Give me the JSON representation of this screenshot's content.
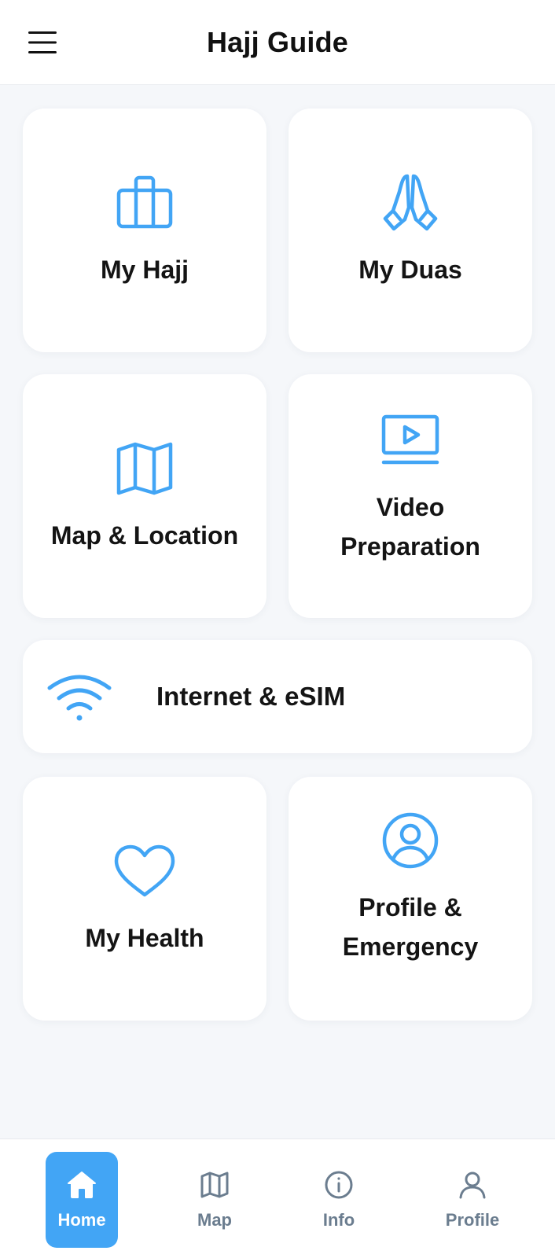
{
  "header": {
    "title": "Hajj Guide",
    "menu_icon": "hamburger-menu-icon"
  },
  "accent_color": "#42A5F5",
  "tiles": [
    {
      "label": "My Hajj",
      "icon": "briefcase-icon"
    },
    {
      "label": "My Duas",
      "icon": "praying-hands-icon"
    },
    {
      "label": "Map & Location",
      "icon": "map-icon"
    },
    {
      "label_lines": [
        "Video",
        "Preparation"
      ],
      "icon": "video-play-icon"
    },
    {
      "label": "My Health",
      "icon": "heart-icon"
    },
    {
      "label_lines": [
        "Profile &",
        "Emergency"
      ],
      "icon": "user-circle-icon"
    }
  ],
  "wide_card": {
    "label": "Internet & eSIM",
    "icon": "wifi-icon"
  },
  "bottom_nav": {
    "active": "Home",
    "items": [
      {
        "label": "Home",
        "icon": "home-icon"
      },
      {
        "label": "Map",
        "icon": "map-icon"
      },
      {
        "label": "Info",
        "icon": "info-icon"
      },
      {
        "label": "Profile",
        "icon": "user-icon"
      }
    ]
  }
}
